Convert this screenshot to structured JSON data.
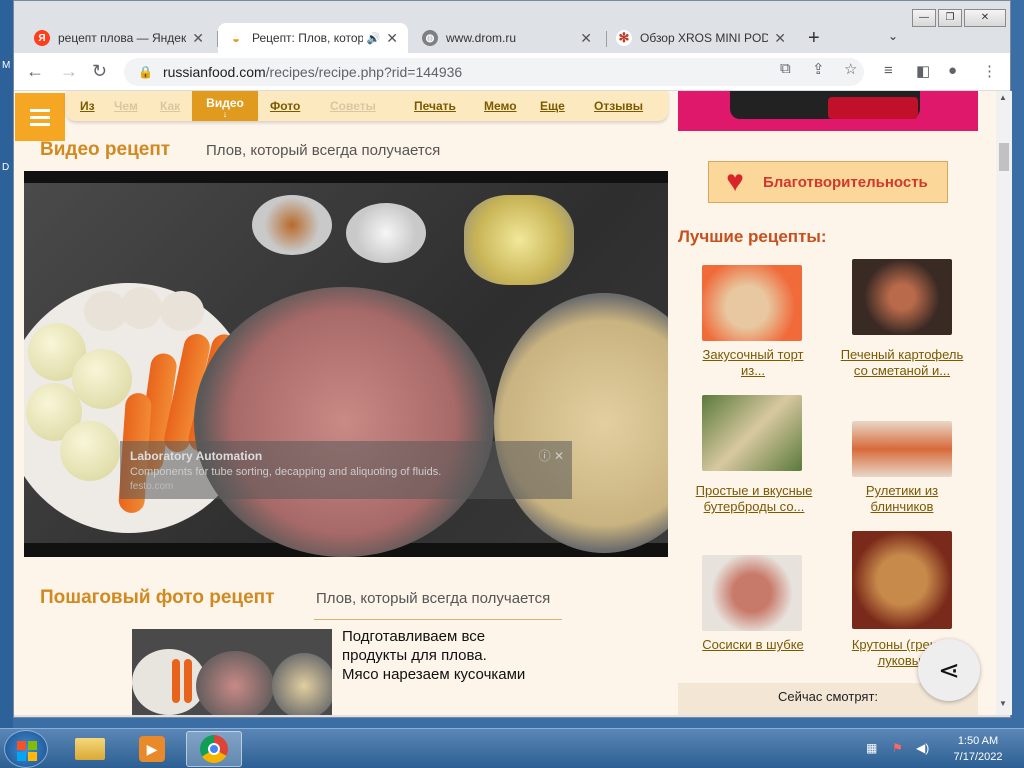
{
  "desktop": {
    "left_chars": [
      "M",
      "D"
    ]
  },
  "window": {
    "controls": [
      "—",
      "❐",
      "✕"
    ]
  },
  "tabs": [
    {
      "title": "рецепт плова — Яндекс",
      "favicon": "Я",
      "favicon_color": "#fc3f1d",
      "active": false
    },
    {
      "title": "Рецепт: Плов, который",
      "favicon": "",
      "favicon_color": "#e09b1f",
      "active": true,
      "audio": true
    },
    {
      "title": "www.drom.ru",
      "favicon": "",
      "favicon_color": "#5f6368",
      "active": false
    },
    {
      "title": "Обзор XROS MINI POD",
      "favicon": "",
      "favicon_color": "#c0392b",
      "active": false
    }
  ],
  "toolbar": {
    "url_host": "russianfood.com",
    "url_path": "/recipes/recipe.php?rid=144936"
  },
  "page": {
    "nav": [
      {
        "label": "Из",
        "faded": false
      },
      {
        "label": "Чем",
        "faded": true
      },
      {
        "label": "Как",
        "faded": true
      },
      {
        "label": "Фото",
        "faded": false
      },
      {
        "label": "Советы",
        "faded": true
      },
      {
        "label": "Печать",
        "faded": false
      },
      {
        "label": "Мемо",
        "faded": false
      },
      {
        "label": "Еще",
        "faded": false
      },
      {
        "label": "Отзывы",
        "faded": false
      }
    ],
    "nav_active": "Видео",
    "nav_active_arrow": "↓",
    "video_section": {
      "title": "Видео рецепт",
      "subtitle": "Плов, который всегда получается"
    },
    "video_ad": {
      "title": "Laboratory Automation",
      "text": "Components for tube sorting, decapping and aliquoting of fluids.",
      "source": "festo.com"
    },
    "photo_section": {
      "title": "Пошаговый фото рецепт",
      "subtitle": "Плов, который всегда получается"
    },
    "step1": [
      "Подготавливаем все",
      "продукты для плова.",
      "Мясо нарезаем кусочками"
    ]
  },
  "sidebar": {
    "charity": "Благотворительность",
    "best_title": "Лучшие рецепты:",
    "recipes": [
      {
        "label_1": "Закусочный торт",
        "label_2": "из...",
        "color_a": "#e8c8a0",
        "color_b": "#f06a3a"
      },
      {
        "label_1": "Печеный картофель",
        "label_2": "со сметаной и...",
        "color_a": "#3a2a24",
        "color_b": "#b86a4a"
      },
      {
        "label_1": "Простые и вкусные",
        "label_2": "бутерброды со...",
        "color_a": "#5a7a3a",
        "color_b": "#d8c8a0"
      },
      {
        "label_1": "Рулетики из",
        "label_2": "блинчиков",
        "color_a": "#d86a3a",
        "color_b": "#e8d8c8"
      },
      {
        "label_1": "Сосиски в шубке",
        "label_2": "",
        "color_a": "#c87a6a",
        "color_b": "#e8e2dc"
      },
      {
        "label_1": "Крутоны (гренки)",
        "label_2": "луковые",
        "color_a": "#c88a4a",
        "color_b": "#7a2a1a"
      }
    ],
    "now_watching": "Сейчас смотрят:"
  },
  "taskbar": {
    "time": "1:50 AM",
    "date": "7/17/2022"
  }
}
